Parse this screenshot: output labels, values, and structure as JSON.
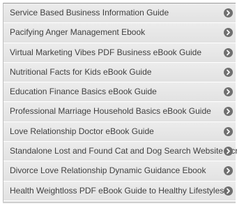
{
  "guide_list": {
    "items": [
      {
        "label": "Service Based Business Information Guide",
        "icon": "chevron-right-circle-icon"
      },
      {
        "label": "Pacifying Anger Management Ebook",
        "icon": "chevron-right-circle-icon"
      },
      {
        "label": "Virtual Marketing Vibes PDF Business eBook Guide",
        "icon": "chevron-right-circle-icon"
      },
      {
        "label": "Nutritional Facts for Kids eBook Guide",
        "icon": "chevron-right-circle-icon"
      },
      {
        "label": "Education Finance Basics eBook Guide",
        "icon": "chevron-right-circle-icon"
      },
      {
        "label": "Professional Marriage Household Basics eBook Guide",
        "icon": "chevron-right-circle-icon"
      },
      {
        "label": "Love Relationship Doctor eBook Guide",
        "icon": "chevron-right-circle-icon"
      },
      {
        "label": "Standalone Lost and Found Cat and Dog Search Website Script",
        "icon": "chevron-right-circle-icon"
      },
      {
        "label": "Divorce Love Relationship Dynamic Guidance Ebook",
        "icon": "chevron-right-circle-icon"
      },
      {
        "label": "Health Weightloss PDF eBook Guide to Healthy Lifestyles",
        "icon": "chevron-right-circle-icon"
      }
    ]
  },
  "colors": {
    "row_background": "#e6e6e6",
    "text": "#3f3f3f",
    "icon_fill": "#6f6f6f"
  }
}
